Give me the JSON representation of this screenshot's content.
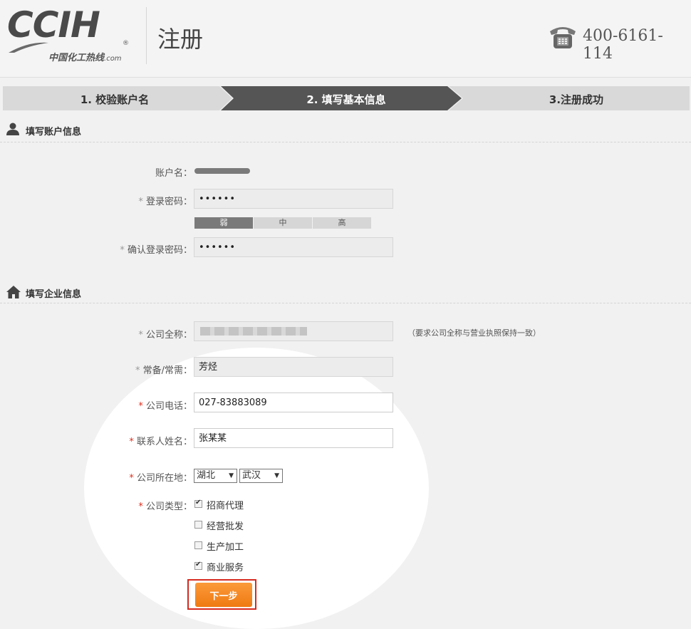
{
  "header": {
    "logo_main": "CCIH",
    "logo_registered": "®",
    "logo_sub": "中国化工热线",
    "logo_domain": ".com",
    "title": "注册",
    "phone_icon": "telephone-icon",
    "phone": "400-6161-114"
  },
  "steps": [
    {
      "label": "1. 校验账户名",
      "state": "done"
    },
    {
      "label": "2. 填写基本信息",
      "state": "active"
    },
    {
      "label": "3.注册成功",
      "state": "pending"
    }
  ],
  "account_section": {
    "icon": "user-icon",
    "title": "填写账户信息",
    "username_label": "账户名：",
    "password_label": "登录密码：",
    "password_value": "••••••",
    "strength": [
      "弱",
      "中",
      "高"
    ],
    "confirm_label": "确认登录密码：",
    "confirm_value": "••••••"
  },
  "company_section": {
    "icon": "home-icon",
    "title": "填写企业信息",
    "name_label": "公司全称：",
    "name_hint": "（要求公司全称与营业执照保持一致）",
    "product_label": "常备/常需：",
    "product_value": "芳烃",
    "phone_label": "公司电话：",
    "phone_value": "027-83883089",
    "contact_label": "联系人姓名：",
    "contact_value": "张某某",
    "location_label": "公司所在地：",
    "province": "湖北",
    "city": "武汉",
    "type_label": "公司类型：",
    "types": [
      {
        "label": "招商代理",
        "checked": true
      },
      {
        "label": "经营批发",
        "checked": false
      },
      {
        "label": "生产加工",
        "checked": false
      },
      {
        "label": "商业服务",
        "checked": true
      }
    ],
    "required_mark": "*"
  },
  "actions": {
    "next_label": "下一步"
  },
  "colors": {
    "accent_orange": "#f08a24",
    "step_active": "#555555",
    "step_inactive": "#d9d9d9",
    "required_red": "#e0301e",
    "highlight_red": "#d52a1f"
  }
}
